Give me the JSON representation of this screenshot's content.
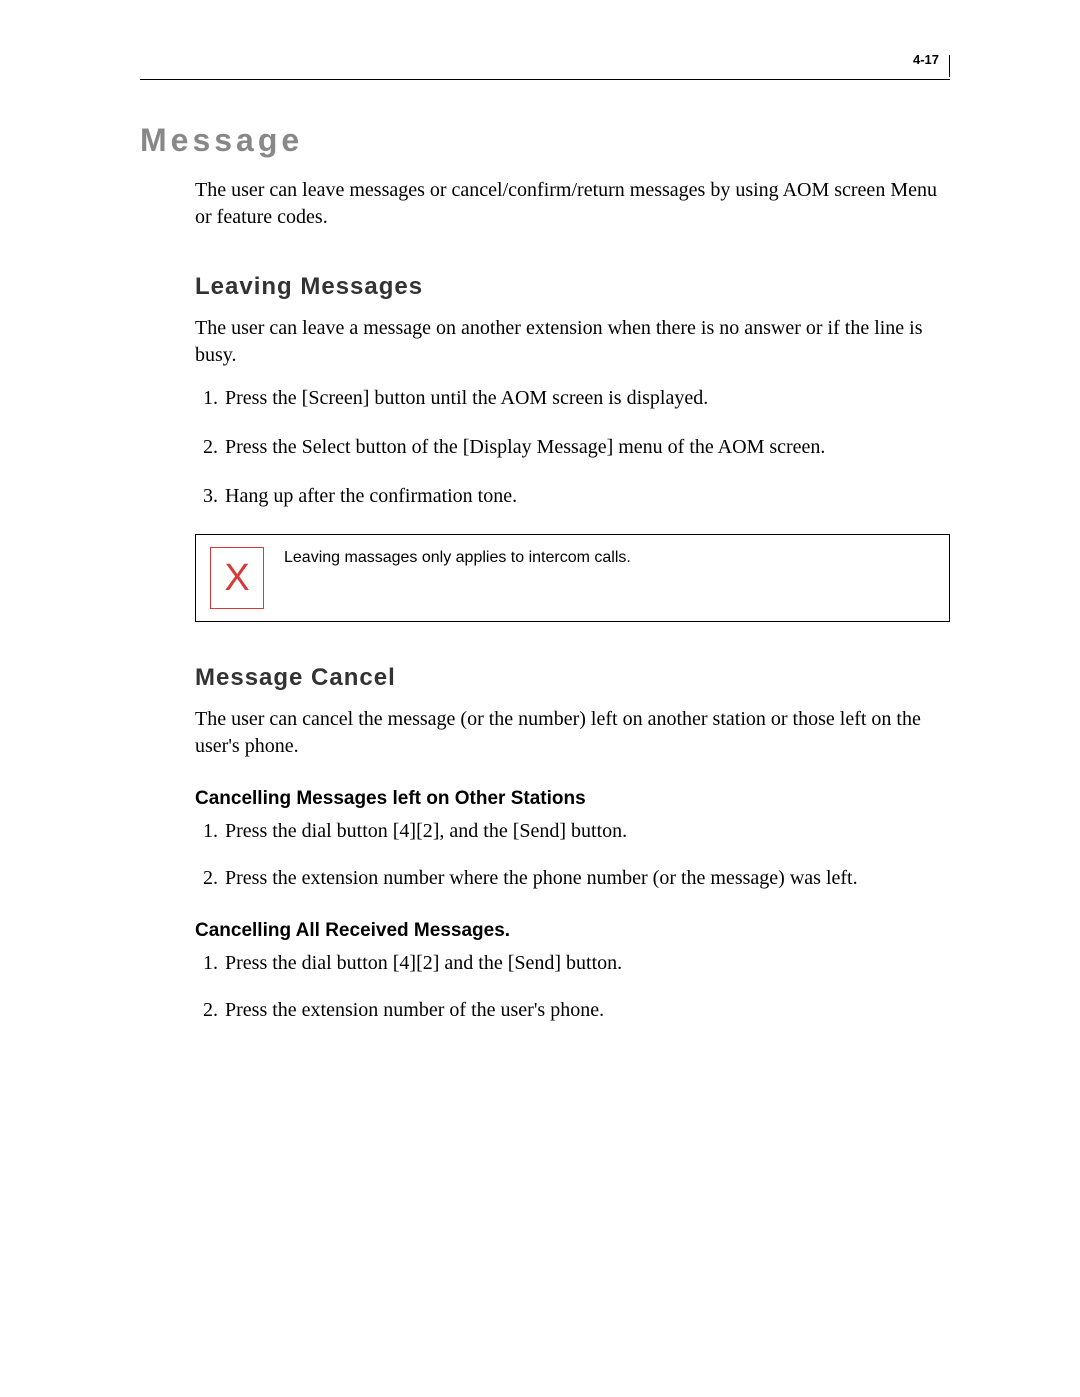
{
  "page_number": "4-17",
  "heading1": "Message",
  "intro": "The user can leave messages or cancel/confirm/return messages by using AOM screen Menu or feature codes.",
  "section_leaving": {
    "title": "Leaving Messages",
    "para": "The user can leave a message on another extension when there is no answer or if the line is busy.",
    "steps": [
      "Press the [Screen] button until the AOM screen is displayed.",
      "Press the Select button of the [Display Message] menu of the AOM screen.",
      "Hang up after the confirmation tone."
    ],
    "note_icon": "X",
    "note_text": "Leaving massages only applies to intercom calls."
  },
  "section_cancel": {
    "title": "Message Cancel",
    "para": "The user can cancel the message (or the number) left on another station or those left on the user's phone.",
    "sub1": {
      "title": "Cancelling Messages left on Other Stations",
      "steps": [
        "Press the dial button [4][2], and the [Send] button.",
        "Press the extension number where the phone number (or the message) was left."
      ]
    },
    "sub2": {
      "title": "Cancelling All Received Messages.",
      "steps": [
        "Press the dial button [4][2] and the [Send] button.",
        "Press the extension number of the user's phone."
      ]
    }
  }
}
